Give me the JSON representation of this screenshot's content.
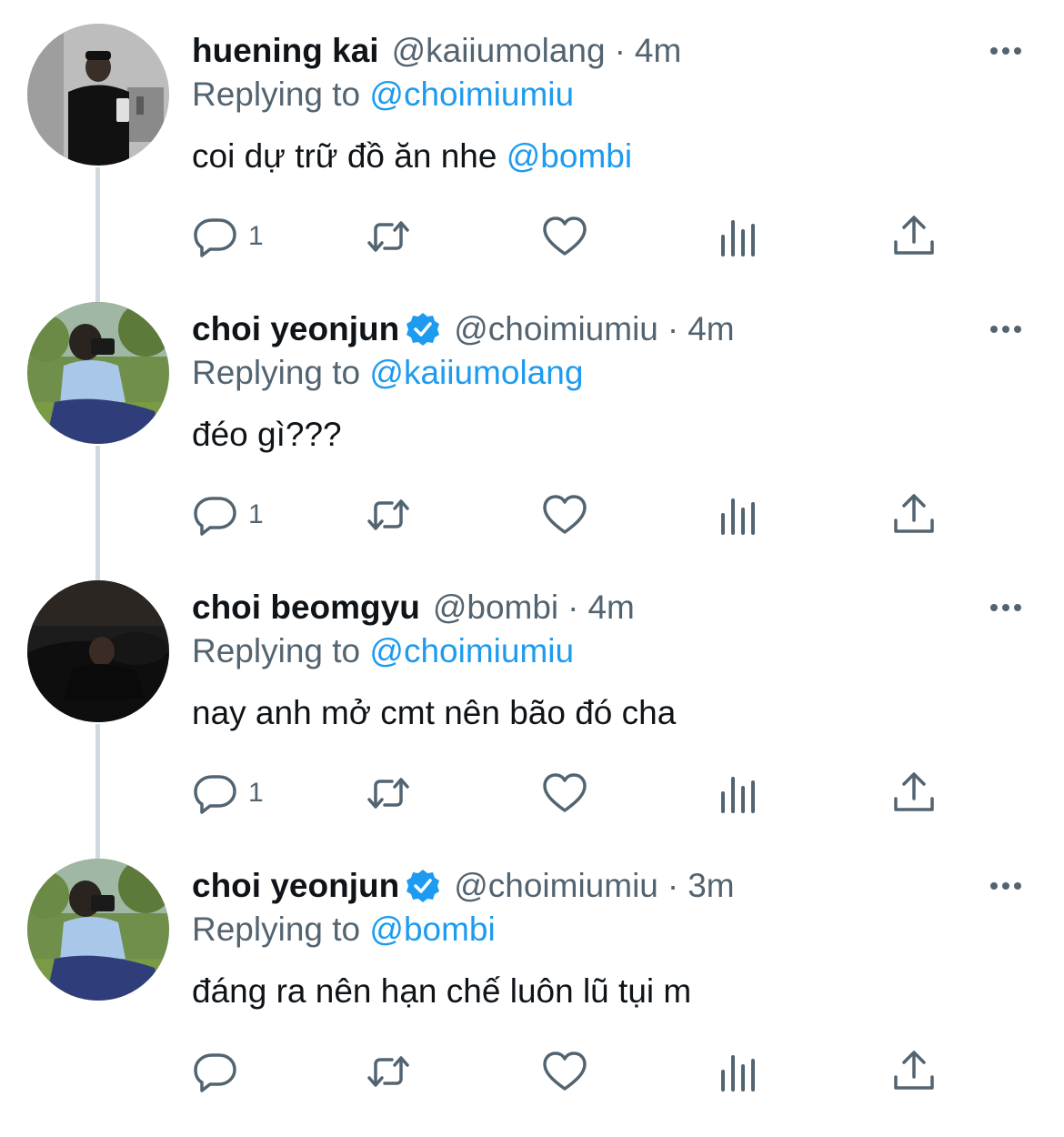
{
  "tweets": [
    {
      "name": "huening kai",
      "verified": false,
      "handle": "@kaiiumolang",
      "separator": "·",
      "time": "4m",
      "replying_prefix": "Replying to ",
      "replying_to": "@choimiumiu",
      "text_plain": "coi dự trữ đồ ăn nhe ",
      "text_mention": "@bombi",
      "reply_count": "1",
      "avatar_icon": "avatar-photo-mirror-selfie"
    },
    {
      "name": "choi yeonjun",
      "verified": true,
      "handle": "@choimiumiu",
      "separator": "·",
      "time": "4m",
      "replying_prefix": "Replying to ",
      "replying_to": "@kaiiumolang",
      "text_plain": "đéo gì???",
      "text_mention": "",
      "reply_count": "1",
      "avatar_icon": "avatar-photo-camera-outdoors"
    },
    {
      "name": "choi beomgyu",
      "verified": false,
      "handle": "@bombi",
      "separator": "·",
      "time": "4m",
      "replying_prefix": "Replying to ",
      "replying_to": "@choimiumiu",
      "text_plain": "nay anh mở cmt nên bão đó cha",
      "text_mention": "",
      "reply_count": "1",
      "avatar_icon": "avatar-photo-sofa-dark"
    },
    {
      "name": "choi yeonjun",
      "verified": true,
      "handle": "@choimiumiu",
      "separator": "·",
      "time": "3m",
      "replying_prefix": "Replying to ",
      "replying_to": "@bombi",
      "text_plain": "đáng ra nên hạn chế luôn lũ tụi m",
      "text_mention": "",
      "reply_count": "",
      "avatar_icon": "avatar-photo-camera-outdoors"
    }
  ],
  "colors": {
    "text": "#0f1419",
    "secondary": "#536471",
    "accent": "#1d9bf0",
    "thread_line": "#cfd9de"
  },
  "icons": [
    "reply-icon",
    "retweet-icon",
    "like-icon",
    "stats-icon",
    "share-icon",
    "more-icon",
    "verified-badge-icon"
  ]
}
